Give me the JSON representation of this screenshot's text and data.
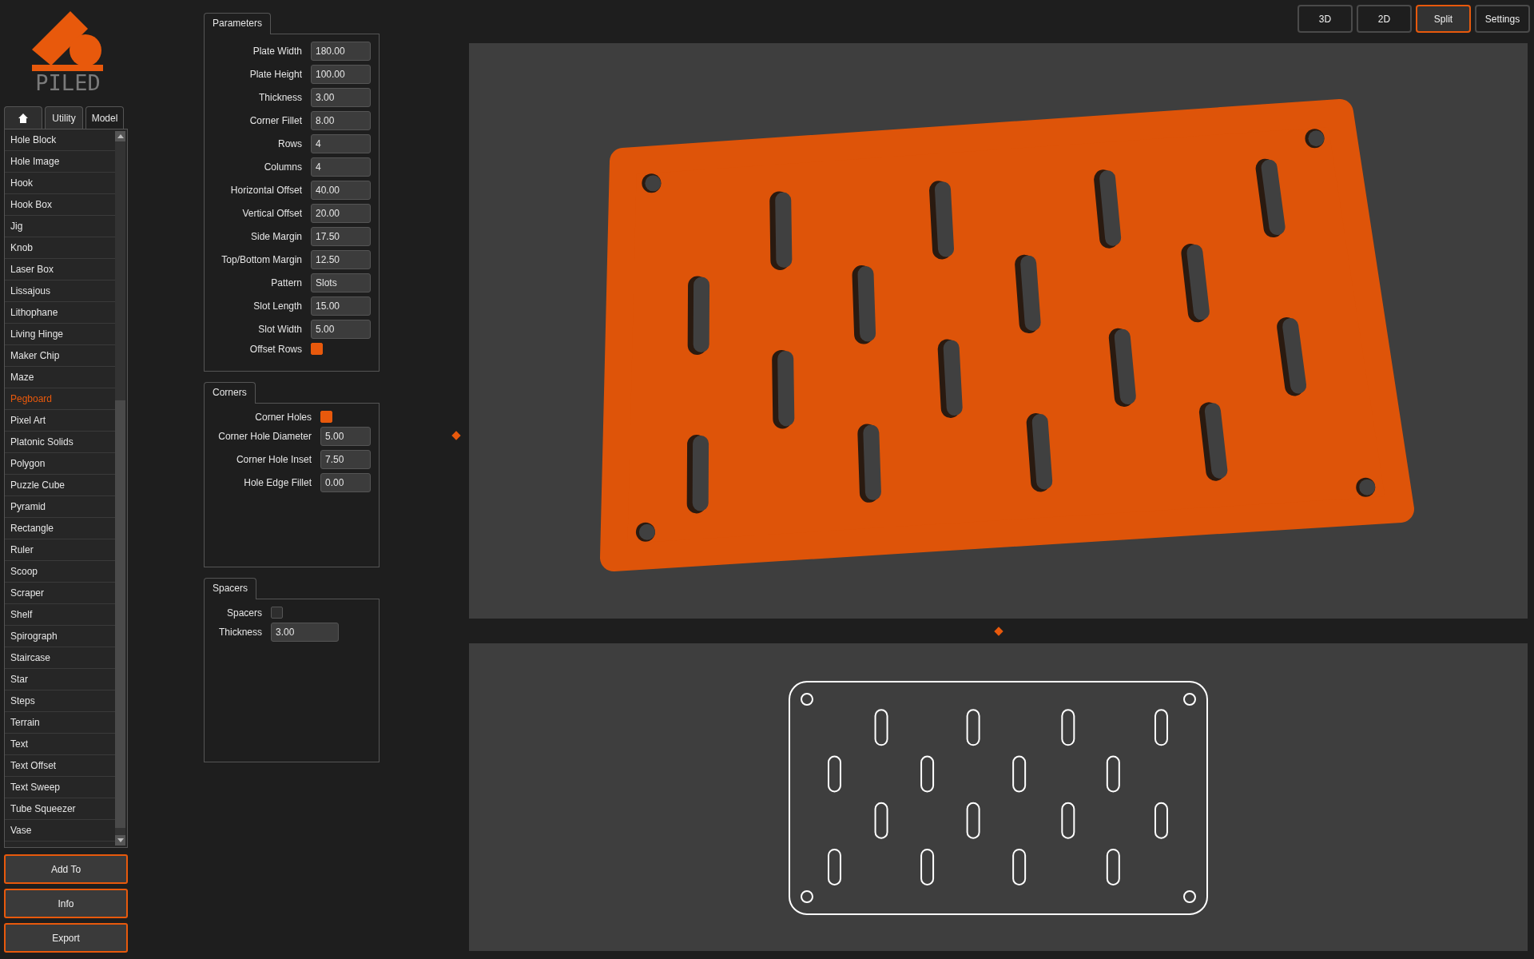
{
  "logo": {
    "text": "PILED"
  },
  "category_tabs": [
    {
      "kind": "icon",
      "selected": false
    },
    {
      "kind": "text",
      "label": "Utility",
      "selected": false
    },
    {
      "kind": "text",
      "label": "Model",
      "selected": true
    }
  ],
  "model_list": [
    {
      "label": "Hole Block",
      "selected": false
    },
    {
      "label": "Hole Image",
      "selected": false
    },
    {
      "label": "Hook",
      "selected": false
    },
    {
      "label": "Hook Box",
      "selected": false
    },
    {
      "label": "Jig",
      "selected": false
    },
    {
      "label": "Knob",
      "selected": false
    },
    {
      "label": "Laser Box",
      "selected": false
    },
    {
      "label": "Lissajous",
      "selected": false
    },
    {
      "label": "Lithophane",
      "selected": false
    },
    {
      "label": "Living Hinge",
      "selected": false
    },
    {
      "label": "Maker Chip",
      "selected": false
    },
    {
      "label": "Maze",
      "selected": false
    },
    {
      "label": "Pegboard",
      "selected": true
    },
    {
      "label": "Pixel Art",
      "selected": false
    },
    {
      "label": "Platonic Solids",
      "selected": false
    },
    {
      "label": "Polygon",
      "selected": false
    },
    {
      "label": "Puzzle Cube",
      "selected": false
    },
    {
      "label": "Pyramid",
      "selected": false
    },
    {
      "label": "Rectangle",
      "selected": false
    },
    {
      "label": "Ruler",
      "selected": false
    },
    {
      "label": "Scoop",
      "selected": false
    },
    {
      "label": "Scraper",
      "selected": false
    },
    {
      "label": "Shelf",
      "selected": false
    },
    {
      "label": "Spirograph",
      "selected": false
    },
    {
      "label": "Staircase",
      "selected": false
    },
    {
      "label": "Star",
      "selected": false
    },
    {
      "label": "Steps",
      "selected": false
    },
    {
      "label": "Terrain",
      "selected": false
    },
    {
      "label": "Text",
      "selected": false
    },
    {
      "label": "Text Offset",
      "selected": false
    },
    {
      "label": "Text Sweep",
      "selected": false
    },
    {
      "label": "Tube Squeezer",
      "selected": false
    },
    {
      "label": "Vase",
      "selected": false
    }
  ],
  "actions": [
    "Add To",
    "Info",
    "Export"
  ],
  "panels": [
    {
      "title": "Parameters",
      "fields": [
        {
          "kind": "input",
          "label": "Plate Width",
          "value": "180.00"
        },
        {
          "kind": "input",
          "label": "Plate Height",
          "value": "100.00"
        },
        {
          "kind": "input",
          "label": "Thickness",
          "value": "3.00"
        },
        {
          "kind": "input",
          "label": "Corner Fillet",
          "value": "8.00"
        },
        {
          "kind": "input",
          "label": "Rows",
          "value": "4"
        },
        {
          "kind": "input",
          "label": "Columns",
          "value": "4"
        },
        {
          "kind": "input",
          "label": "Horizontal Offset",
          "value": "40.00"
        },
        {
          "kind": "input",
          "label": "Vertical Offset",
          "value": "20.00"
        },
        {
          "kind": "input",
          "label": "Side Margin",
          "value": "17.50"
        },
        {
          "kind": "input",
          "label": "Top/Bottom Margin",
          "value": "12.50"
        },
        {
          "kind": "input",
          "label": "Pattern",
          "value": "Slots"
        },
        {
          "kind": "input",
          "label": "Slot Length",
          "value": "15.00"
        },
        {
          "kind": "input",
          "label": "Slot Width",
          "value": "5.00"
        },
        {
          "kind": "checkbox",
          "label": "Offset Rows",
          "checked": true
        }
      ]
    },
    {
      "title": "Corners",
      "fields": [
        {
          "kind": "checkbox",
          "label": "Corner Holes",
          "checked": true
        },
        {
          "kind": "input",
          "label": "Corner Hole Diameter",
          "value": "5.00"
        },
        {
          "kind": "input",
          "label": "Corner Hole Inset",
          "value": "7.50"
        },
        {
          "kind": "input",
          "label": "Hole Edge Fillet",
          "value": "0.00"
        }
      ]
    },
    {
      "title": "Spacers",
      "fields": [
        {
          "kind": "checkbox",
          "label": "Spacers",
          "checked": false
        },
        {
          "kind": "input",
          "label": "Thickness",
          "value": "3.00"
        }
      ]
    }
  ],
  "view_modes": [
    {
      "label": "3D",
      "selected": false
    },
    {
      "label": "2D",
      "selected": false
    },
    {
      "label": "Split",
      "selected": true
    },
    {
      "label": "Settings",
      "selected": false
    }
  ]
}
